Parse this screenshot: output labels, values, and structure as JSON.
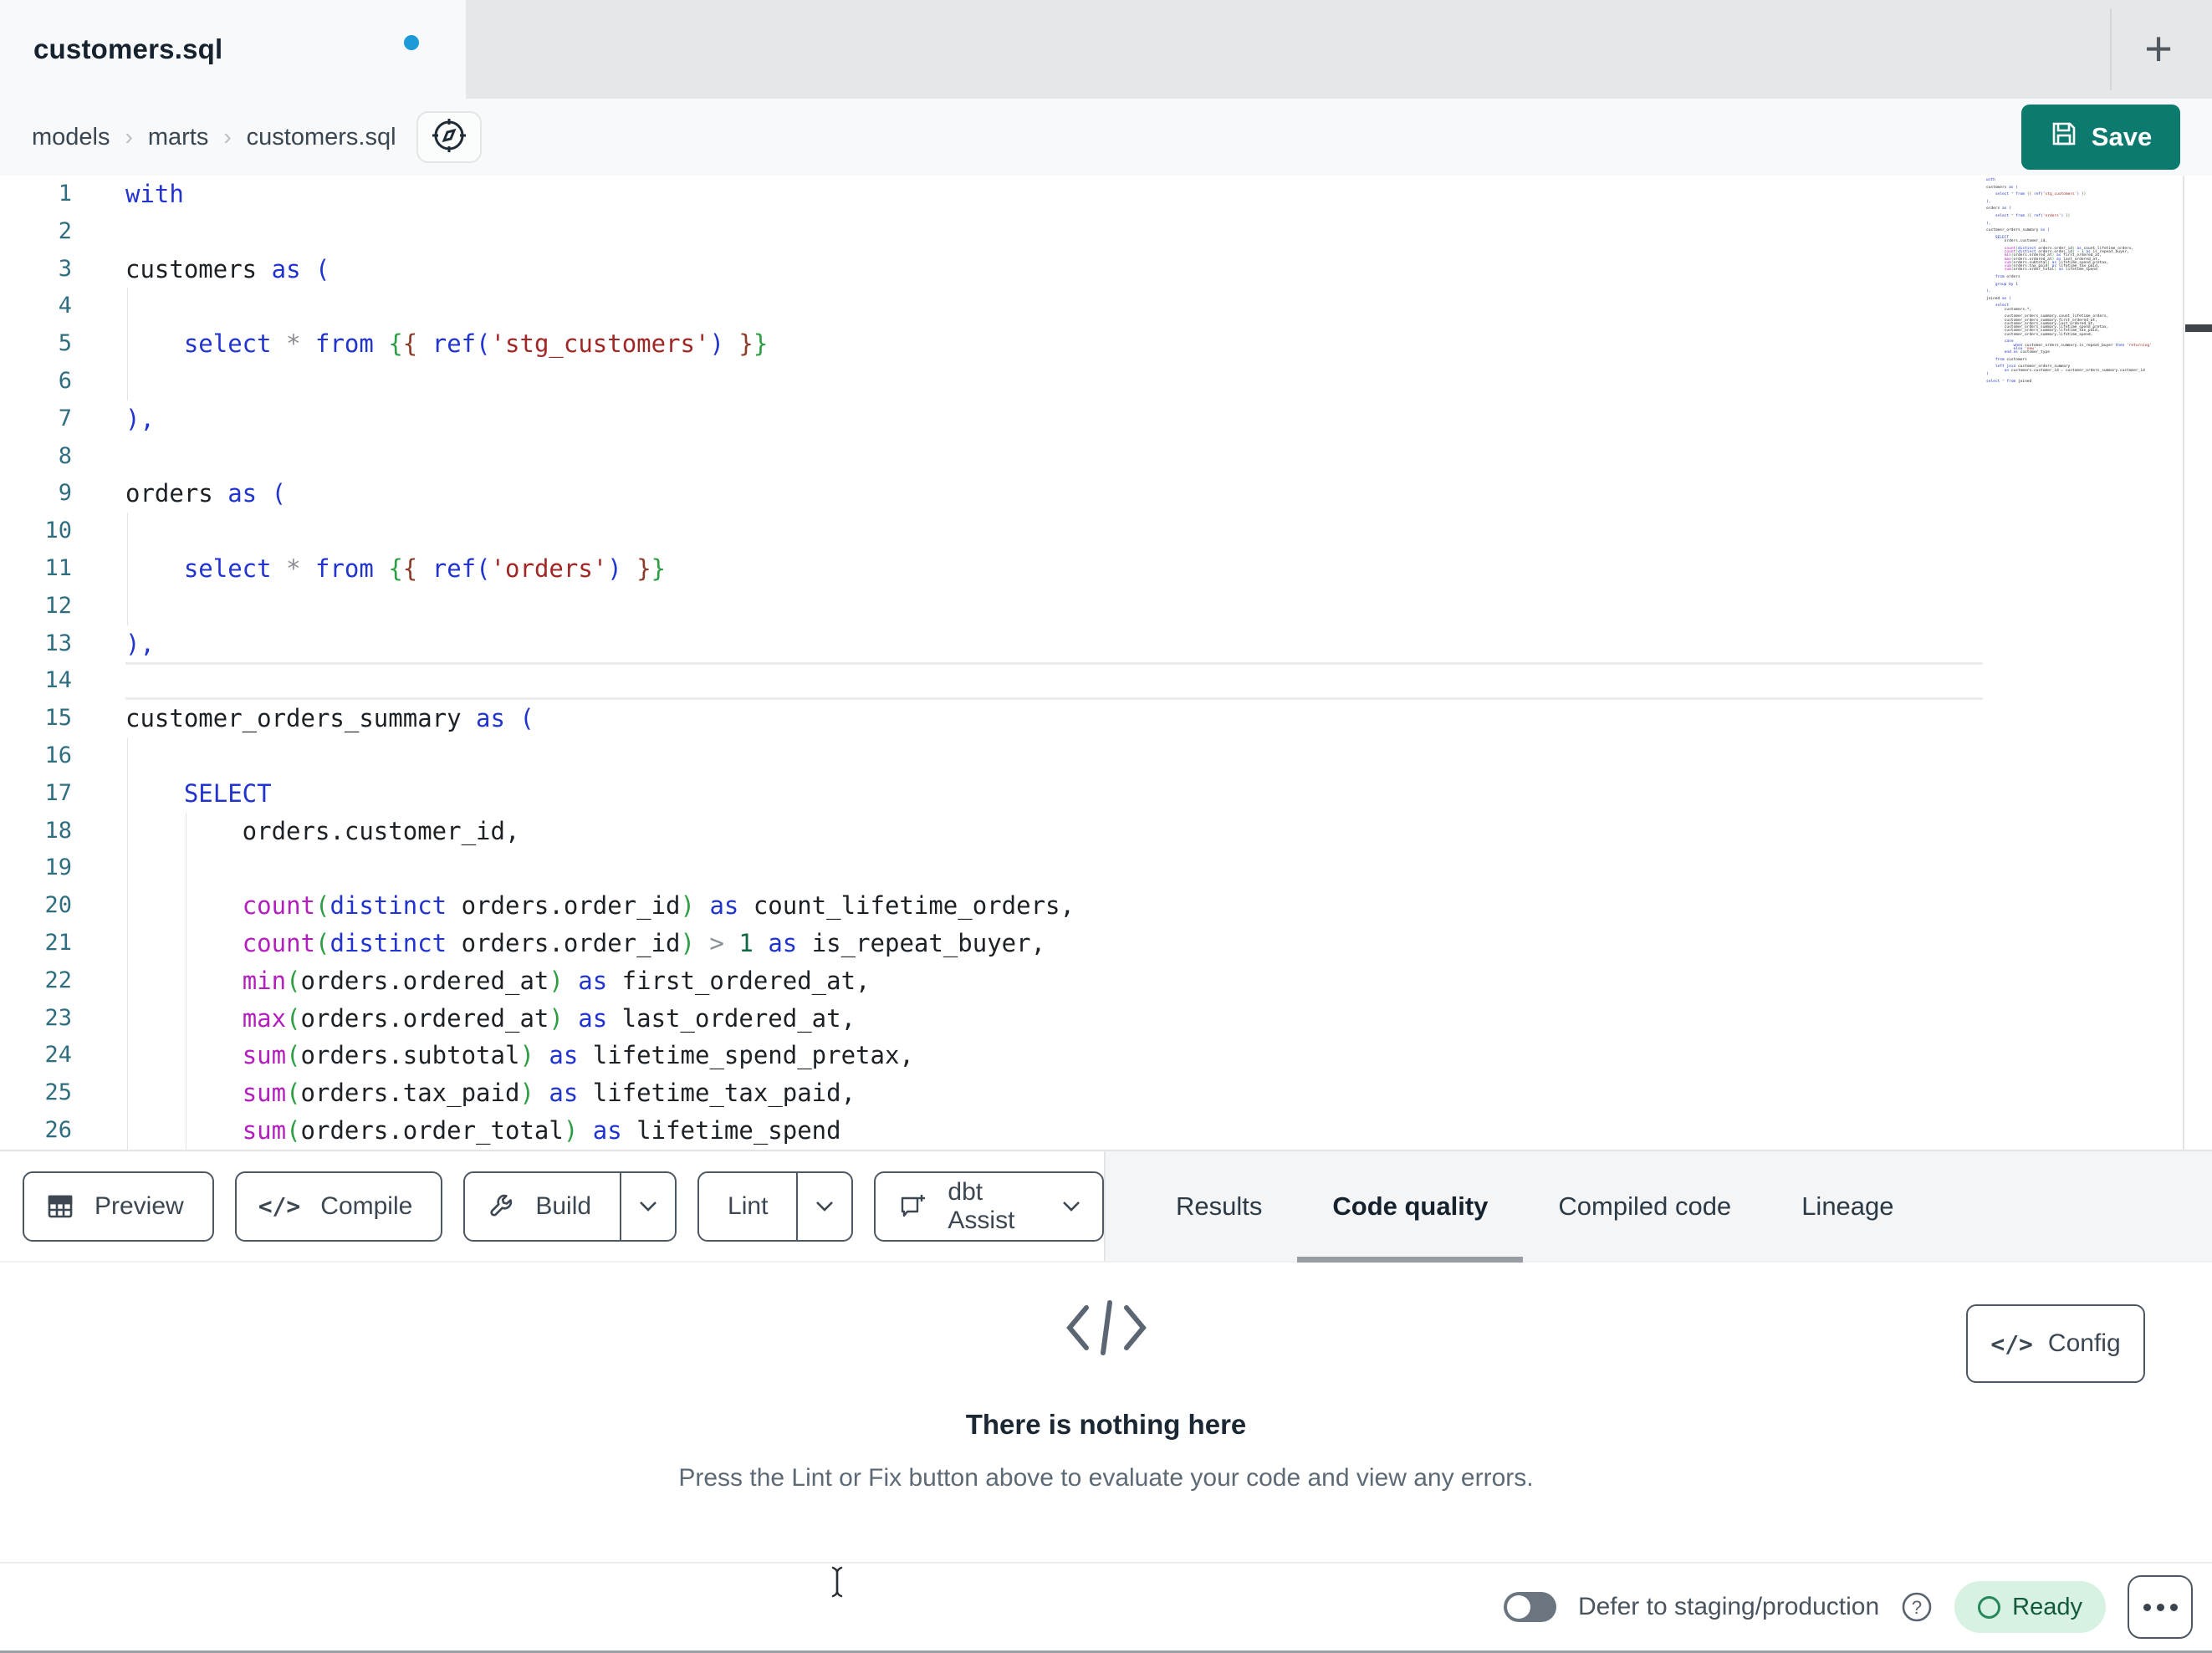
{
  "tab_bar": {
    "active_tab": "customers.sql",
    "new_tab_label": "+"
  },
  "breadcrumb": {
    "items": [
      "models",
      "marts",
      "customers.sql"
    ],
    "separator": "›"
  },
  "header": {
    "save_label": "Save"
  },
  "colors": {
    "accent_teal": "#0c7a6e",
    "unsaved_dot_blue": "#1d9bd8",
    "ready_badge_bg": "#d7f2e2",
    "ready_badge_text": "#15593d",
    "keyword_blue": "#2134cf",
    "function_magenta": "#b31fbd",
    "string_red": "#a02725",
    "gutter_teal": "#2f6e80"
  },
  "editor": {
    "active_line": 14,
    "lines": [
      {
        "g": [],
        "tk": [
          [
            "k",
            "with"
          ]
        ]
      },
      {
        "g": [],
        "tk": []
      },
      {
        "g": [],
        "tk": [
          [
            "t",
            "customers "
          ],
          [
            "k",
            "as"
          ],
          [
            "t",
            " "
          ],
          [
            "k",
            "("
          ]
        ]
      },
      {
        "g": [
          0
        ],
        "tk": []
      },
      {
        "g": [
          0
        ],
        "tk": [
          [
            "t",
            "    "
          ],
          [
            "k",
            "select"
          ],
          [
            "t",
            " "
          ],
          [
            "o",
            "*"
          ],
          [
            "t",
            " "
          ],
          [
            "k",
            "from"
          ],
          [
            "t",
            " "
          ],
          [
            "jg",
            "{"
          ],
          [
            "jm",
            "{"
          ],
          [
            "t",
            " "
          ],
          [
            "k",
            "ref("
          ],
          [
            "s",
            "'stg_customers'"
          ],
          [
            "k",
            ")"
          ],
          [
            "t",
            " "
          ],
          [
            "jm",
            "}"
          ],
          [
            "jg",
            "}"
          ]
        ]
      },
      {
        "g": [
          0
        ],
        "tk": []
      },
      {
        "g": [],
        "tk": [
          [
            "k",
            "),"
          ]
        ]
      },
      {
        "g": [],
        "tk": []
      },
      {
        "g": [],
        "tk": [
          [
            "t",
            "orders "
          ],
          [
            "k",
            "as"
          ],
          [
            "t",
            " "
          ],
          [
            "k",
            "("
          ]
        ]
      },
      {
        "g": [
          0
        ],
        "tk": []
      },
      {
        "g": [
          0
        ],
        "tk": [
          [
            "t",
            "    "
          ],
          [
            "k",
            "select"
          ],
          [
            "t",
            " "
          ],
          [
            "o",
            "*"
          ],
          [
            "t",
            " "
          ],
          [
            "k",
            "from"
          ],
          [
            "t",
            " "
          ],
          [
            "jg",
            "{"
          ],
          [
            "jm",
            "{"
          ],
          [
            "t",
            " "
          ],
          [
            "k",
            "ref("
          ],
          [
            "s",
            "'orders'"
          ],
          [
            "k",
            ")"
          ],
          [
            "t",
            " "
          ],
          [
            "jm",
            "}"
          ],
          [
            "jg",
            "}"
          ]
        ]
      },
      {
        "g": [
          0
        ],
        "tk": []
      },
      {
        "g": [],
        "tk": [
          [
            "k",
            "),"
          ]
        ]
      },
      {
        "g": [],
        "tk": []
      },
      {
        "g": [],
        "tk": [
          [
            "t",
            "customer_orders_summary "
          ],
          [
            "k",
            "as"
          ],
          [
            "t",
            " "
          ],
          [
            "k",
            "("
          ]
        ]
      },
      {
        "g": [
          0
        ],
        "tk": []
      },
      {
        "g": [
          0
        ],
        "tk": [
          [
            "t",
            "    "
          ],
          [
            "k",
            "SELECT"
          ]
        ]
      },
      {
        "g": [
          0,
          4
        ],
        "tk": [
          [
            "t",
            "        orders.customer_id,"
          ]
        ]
      },
      {
        "g": [
          0,
          4
        ],
        "tk": []
      },
      {
        "g": [
          0,
          4
        ],
        "tk": [
          [
            "t",
            "        "
          ],
          [
            "f",
            "count"
          ],
          [
            "pg",
            "("
          ],
          [
            "k",
            "distinct"
          ],
          [
            "t",
            " orders.order_id"
          ],
          [
            "pg",
            ")"
          ],
          [
            "t",
            " "
          ],
          [
            "k",
            "as"
          ],
          [
            "t",
            " count_lifetime_orders,"
          ]
        ]
      },
      {
        "g": [
          0,
          4
        ],
        "tk": [
          [
            "t",
            "        "
          ],
          [
            "f",
            "count"
          ],
          [
            "pg",
            "("
          ],
          [
            "k",
            "distinct"
          ],
          [
            "t",
            " orders.order_id"
          ],
          [
            "pg",
            ")"
          ],
          [
            "t",
            " "
          ],
          [
            "o",
            ">"
          ],
          [
            "t",
            " "
          ],
          [
            "n",
            "1"
          ],
          [
            "t",
            " "
          ],
          [
            "k",
            "as"
          ],
          [
            "t",
            " is_repeat_buyer,"
          ]
        ]
      },
      {
        "g": [
          0,
          4
        ],
        "tk": [
          [
            "t",
            "        "
          ],
          [
            "f",
            "min"
          ],
          [
            "pg",
            "("
          ],
          [
            "t",
            "orders.ordered_at"
          ],
          [
            "pg",
            ")"
          ],
          [
            "t",
            " "
          ],
          [
            "k",
            "as"
          ],
          [
            "t",
            " first_ordered_at,"
          ]
        ]
      },
      {
        "g": [
          0,
          4
        ],
        "tk": [
          [
            "t",
            "        "
          ],
          [
            "f",
            "max"
          ],
          [
            "pg",
            "("
          ],
          [
            "t",
            "orders.ordered_at"
          ],
          [
            "pg",
            ")"
          ],
          [
            "t",
            " "
          ],
          [
            "k",
            "as"
          ],
          [
            "t",
            " last_ordered_at,"
          ]
        ]
      },
      {
        "g": [
          0,
          4
        ],
        "tk": [
          [
            "t",
            "        "
          ],
          [
            "f",
            "sum"
          ],
          [
            "pg",
            "("
          ],
          [
            "t",
            "orders.subtotal"
          ],
          [
            "pg",
            ")"
          ],
          [
            "t",
            " "
          ],
          [
            "k",
            "as"
          ],
          [
            "t",
            " lifetime_spend_pretax,"
          ]
        ]
      },
      {
        "g": [
          0,
          4
        ],
        "tk": [
          [
            "t",
            "        "
          ],
          [
            "f",
            "sum"
          ],
          [
            "pg",
            "("
          ],
          [
            "t",
            "orders.tax_paid"
          ],
          [
            "pg",
            ")"
          ],
          [
            "t",
            " "
          ],
          [
            "k",
            "as"
          ],
          [
            "t",
            " lifetime_tax_paid,"
          ]
        ]
      },
      {
        "g": [
          0,
          4
        ],
        "tk": [
          [
            "t",
            "        "
          ],
          [
            "f",
            "sum"
          ],
          [
            "pg",
            "("
          ],
          [
            "t",
            "orders.order_total"
          ],
          [
            "pg",
            ")"
          ],
          [
            "t",
            " "
          ],
          [
            "k",
            "as"
          ],
          [
            "t",
            " lifetime_spend"
          ]
        ]
      }
    ],
    "extra_lines": [
      {
        "tk": []
      },
      {
        "tk": [
          [
            "t",
            "    "
          ],
          [
            "k",
            "from"
          ],
          [
            "t",
            " orders"
          ]
        ]
      },
      {
        "tk": []
      },
      {
        "tk": [
          [
            "t",
            "    "
          ],
          [
            "k",
            "group by"
          ],
          [
            "t",
            " "
          ],
          [
            "n",
            "1"
          ]
        ]
      },
      {
        "tk": []
      },
      {
        "tk": [
          [
            "k",
            "),"
          ]
        ]
      },
      {
        "tk": []
      },
      {
        "tk": [
          [
            "t",
            "joined "
          ],
          [
            "k",
            "as"
          ],
          [
            "t",
            " "
          ],
          [
            "k",
            "("
          ]
        ]
      },
      {
        "tk": []
      },
      {
        "tk": [
          [
            "t",
            "    "
          ],
          [
            "k",
            "select"
          ]
        ]
      },
      {
        "tk": [
          [
            "t",
            "        customers.*,"
          ]
        ]
      },
      {
        "tk": []
      },
      {
        "tk": [
          [
            "t",
            "        customer_orders_summary.count_lifetime_orders,"
          ]
        ]
      },
      {
        "tk": [
          [
            "t",
            "        customer_orders_summary.first_ordered_at,"
          ]
        ]
      },
      {
        "tk": [
          [
            "t",
            "        customer_orders_summary.last_ordered_at,"
          ]
        ]
      },
      {
        "tk": [
          [
            "t",
            "        customer_orders_summary.lifetime_spend_pretax,"
          ]
        ]
      },
      {
        "tk": [
          [
            "t",
            "        customer_orders_summary.lifetime_tax_paid,"
          ]
        ]
      },
      {
        "tk": [
          [
            "t",
            "        customer_orders_summary.lifetime_spend,"
          ]
        ]
      },
      {
        "tk": []
      },
      {
        "tk": [
          [
            "t",
            "        "
          ],
          [
            "k",
            "case"
          ]
        ]
      },
      {
        "tk": [
          [
            "t",
            "            "
          ],
          [
            "k",
            "when"
          ],
          [
            "t",
            " customer_orders_summary.is_repeat_buyer "
          ],
          [
            "k",
            "then"
          ],
          [
            "t",
            " "
          ],
          [
            "s",
            "'returning'"
          ]
        ]
      },
      {
        "tk": [
          [
            "t",
            "            "
          ],
          [
            "k",
            "else"
          ],
          [
            "t",
            " "
          ],
          [
            "s",
            "'new'"
          ]
        ]
      },
      {
        "tk": [
          [
            "t",
            "        "
          ],
          [
            "k",
            "end"
          ],
          [
            "t",
            " "
          ],
          [
            "k",
            "as"
          ],
          [
            "t",
            " customer_type"
          ]
        ]
      },
      {
        "tk": []
      },
      {
        "tk": [
          [
            "t",
            "    "
          ],
          [
            "k",
            "from"
          ],
          [
            "t",
            " customers"
          ]
        ]
      },
      {
        "tk": []
      },
      {
        "tk": [
          [
            "t",
            "    "
          ],
          [
            "k",
            "left join"
          ],
          [
            "t",
            " customer_orders_summary"
          ]
        ]
      },
      {
        "tk": [
          [
            "t",
            "        "
          ],
          [
            "k",
            "on"
          ],
          [
            "t",
            " customers.customer_id "
          ],
          [
            "o",
            "="
          ],
          [
            "t",
            " customer_orders_summary.customer_id"
          ]
        ]
      },
      {
        "tk": [
          [
            "k",
            ")"
          ]
        ]
      },
      {
        "tk": []
      },
      {
        "tk": [
          [
            "k",
            "select"
          ],
          [
            "t",
            " "
          ],
          [
            "o",
            "*"
          ],
          [
            "t",
            " "
          ],
          [
            "k",
            "from"
          ],
          [
            "t",
            " joined"
          ]
        ]
      }
    ]
  },
  "toolbar": {
    "preview_label": "Preview",
    "compile_label": "Compile",
    "build_label": "Build",
    "lint_label": "Lint",
    "assist_label": "dbt Assist",
    "tabs": [
      {
        "label": "Results",
        "active": false
      },
      {
        "label": "Code quality",
        "active": true
      },
      {
        "label": "Compiled code",
        "active": false
      },
      {
        "label": "Lineage",
        "active": false
      }
    ]
  },
  "panel": {
    "title": "There is nothing here",
    "description": "Press the Lint or Fix button above to evaluate your code and view any errors.",
    "config_label": "Config"
  },
  "status_bar": {
    "defer_label": "Defer to staging/production",
    "ready_label": "Ready"
  }
}
